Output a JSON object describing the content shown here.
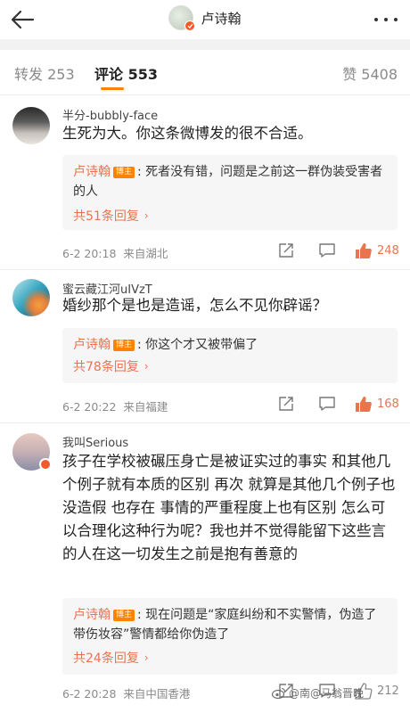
{
  "header": {
    "title": "卢诗翰",
    "back_icon": "back-arrow-icon",
    "more_icon": "more-dots-icon"
  },
  "tabs": {
    "repost": "转发 253",
    "comment": "评论 553",
    "like": "赞 5408",
    "active": "comment",
    "accent": "#ff8200"
  },
  "colors": {
    "link": "#eb7350",
    "verified": "#f25a2b",
    "like_active": "#eb7350"
  },
  "comments": [
    {
      "user": "半分-bubbly-face",
      "text": "生死为大。你这条微博发的很不合适。",
      "reply": {
        "author": "卢诗翰",
        "tag": "博主",
        "text": ": 死者没有错，问题是之前这一群伪装受害者的人",
        "count": "共51条回复"
      },
      "time": "6-2 20:18",
      "location": "来自湖北",
      "likes": "248",
      "liked": true
    },
    {
      "user": "蜜云藏江河uIVzT",
      "text": "婚纱那个是也是造谣，怎么不见你辟谣？",
      "reply": {
        "author": "卢诗翰",
        "tag": "博主",
        "text": ": 你这个才又被带偏了",
        "count": "共78条回复"
      },
      "time": "6-2 20:22",
      "location": "来自福建",
      "likes": "168",
      "liked": true
    },
    {
      "user": "我叫Serious",
      "text": "孩子在学校被碾压身亡是被证实过的事实 和其他几个例子就有本质的区别 再次 就算是其他几个例子也没造假 也存在 事情的严重程度上也有区别 怎么可以合理化这种行为呢？我也并不觉得能留下这些言的人在这一切发生之前是抱有善意的",
      "reply": {
        "author": "卢诗翰",
        "tag": "博主",
        "text": ": 现在问题是“家庭纠纷和不实警情，伪造了带伤妆容”警情都给你伪造了",
        "count": "共24条回复"
      },
      "time": "6-2 20:28",
      "location": "来自中国香港",
      "likes": "212",
      "liked": false
    }
  ],
  "watermark": "@南@马翁晋晚"
}
